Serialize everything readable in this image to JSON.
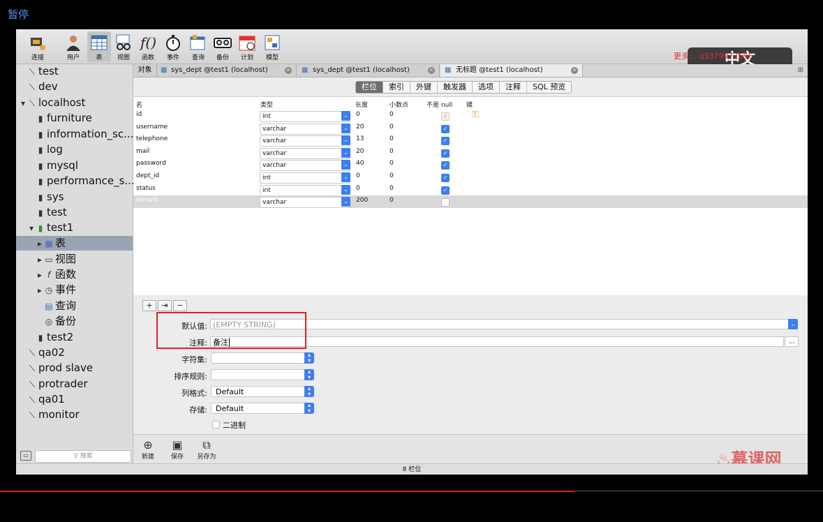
{
  "pause_label": "暂停",
  "toolbar": {
    "buttons": [
      "连接",
      "用户",
      "表",
      "视图",
      "函数",
      "事件",
      "查询",
      "备份",
      "计划",
      "模型"
    ]
  },
  "watermark_text": "更多…                    q3379977696",
  "sidebar": {
    "items": [
      "test",
      "dev",
      "localhost",
      "furniture",
      "information_sc...",
      "log",
      "mysql",
      "performance_s...",
      "sys",
      "test",
      "test1",
      "表",
      "视图",
      "函数",
      "事件",
      "查询",
      "备份",
      "test2",
      "qa02",
      "prod slave",
      "protrader",
      "qa01",
      "monitor"
    ],
    "search_placeholder": "搜索"
  },
  "tabs": [
    "对象",
    "sys_dept @test1 (localhost)",
    "sys_dept @test1 (localhost)",
    "无标题 @test1 (localhost)"
  ],
  "segments": [
    "栏位",
    "索引",
    "外键",
    "触发器",
    "选项",
    "注释",
    "SQL 预览"
  ],
  "grid": {
    "headers": [
      "名",
      "类型",
      "长度",
      "小数点",
      "不是 null",
      "键"
    ],
    "rows": [
      {
        "name": "id",
        "type": "int",
        "length": "0",
        "decimals": "0",
        "not_null": true
      },
      {
        "name": "username",
        "type": "varchar",
        "length": "20",
        "decimals": "0",
        "not_null": true
      },
      {
        "name": "telephone",
        "type": "varchar",
        "length": "13",
        "decimals": "0",
        "not_null": true
      },
      {
        "name": "mail",
        "type": "varchar",
        "length": "20",
        "decimals": "0",
        "not_null": true
      },
      {
        "name": "password",
        "type": "varchar",
        "length": "40",
        "decimals": "0",
        "not_null": true
      },
      {
        "name": "dept_id",
        "type": "int",
        "length": "0",
        "decimals": "0",
        "not_null": true
      },
      {
        "name": "status",
        "type": "int",
        "length": "0",
        "decimals": "0",
        "not_null": true
      },
      {
        "name": "remark",
        "type": "varchar",
        "length": "200",
        "decimals": "0",
        "not_null": false
      }
    ]
  },
  "properties": {
    "default_label": "默认值:",
    "default_placeholder": "(EMPTY STRING)",
    "comment_label": "注释:",
    "comment_value": "备注",
    "charset_label": "字符集:",
    "collation_label": "排序规则:",
    "column_format_label": "列格式:",
    "column_format_value": "Default",
    "storage_label": "存储:",
    "storage_value": "Default",
    "binary_label": "二进制"
  },
  "bottom_buttons": [
    "新建",
    "保存",
    "另存为"
  ],
  "status_text": "8 栏位",
  "zh_overlay": "中文",
  "logo_text": "慕课网"
}
